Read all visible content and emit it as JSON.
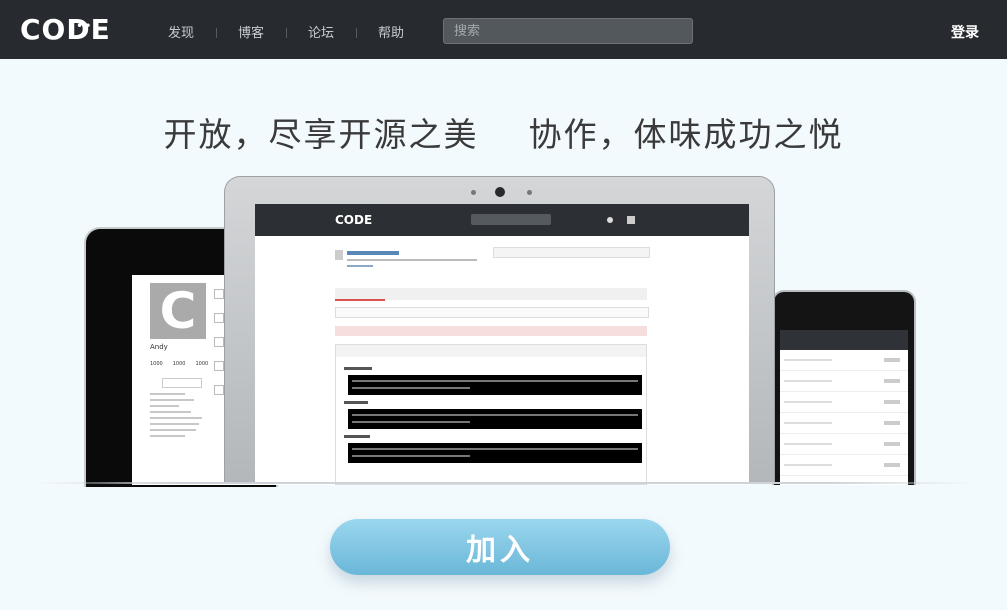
{
  "header": {
    "logo": "CODE",
    "nav": [
      "发现",
      "博客",
      "论坛",
      "帮助"
    ],
    "search_placeholder": "搜索",
    "login": "登录"
  },
  "hero": {
    "tagline": "开放，尽享开源之美    协作，体味成功之悦",
    "join_button": "加入"
  },
  "devices": {
    "left_tablet": {
      "avatar_letter": "C",
      "name": "Andy",
      "stats": [
        "1000",
        "1000",
        "1000"
      ]
    }
  },
  "colors": {
    "navbar_bg": "#272b2f",
    "page_bg": "#f3fafd",
    "button_gradient_top": "#9bd6ee",
    "button_gradient_bottom": "#6ab7d8"
  }
}
